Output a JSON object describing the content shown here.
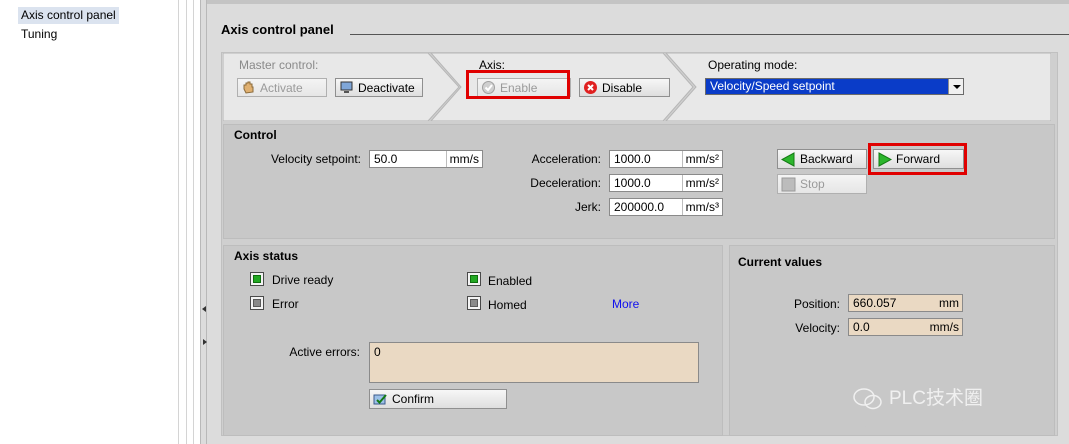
{
  "nav": {
    "items": [
      "Axis control panel",
      "Tuning"
    ]
  },
  "panel": {
    "title": "Axis control panel"
  },
  "master_control": {
    "label": "Master control:",
    "activate_label": "Activate",
    "deactivate_label": "Deactivate"
  },
  "axis": {
    "label": "Axis:",
    "enable_label": "Enable",
    "disable_label": "Disable"
  },
  "operating_mode": {
    "label": "Operating mode:",
    "selected": "Velocity/Speed setpoint"
  },
  "control": {
    "title": "Control",
    "velocity_setpoint": {
      "label": "Velocity setpoint:",
      "value": "50.0",
      "unit": "mm/s"
    },
    "acceleration": {
      "label": "Acceleration:",
      "value": "1000.0",
      "unit": "mm/s²"
    },
    "deceleration": {
      "label": "Deceleration:",
      "value": "1000.0",
      "unit": "mm/s²"
    },
    "jerk": {
      "label": "Jerk:",
      "value": "200000.0",
      "unit": "mm/s³"
    },
    "backward_label": "Backward",
    "forward_label": "Forward",
    "stop_label": "Stop"
  },
  "axis_status": {
    "title": "Axis status",
    "drive_ready": "Drive ready",
    "error": "Error",
    "enabled": "Enabled",
    "homed": "Homed",
    "more_link": "More",
    "active_errors_label": "Active errors:",
    "active_errors_value": "0",
    "confirm_label": "Confirm"
  },
  "current_values": {
    "title": "Current values",
    "position": {
      "label": "Position:",
      "value": "660.057",
      "unit": "mm"
    },
    "velocity": {
      "label": "Velocity:",
      "value": "0.0",
      "unit": "mm/s"
    }
  },
  "watermark": {
    "logo_text": "PLC技术圈",
    "url": "https://blog.csdn.net/qq_45172832"
  },
  "colors": {
    "highlight_box": "#e00000",
    "selected_mode_bg": "#0a3cc8",
    "led_on": "#22a822",
    "readonly_field_bg": "#ead9c3",
    "link": "#1010ee"
  }
}
